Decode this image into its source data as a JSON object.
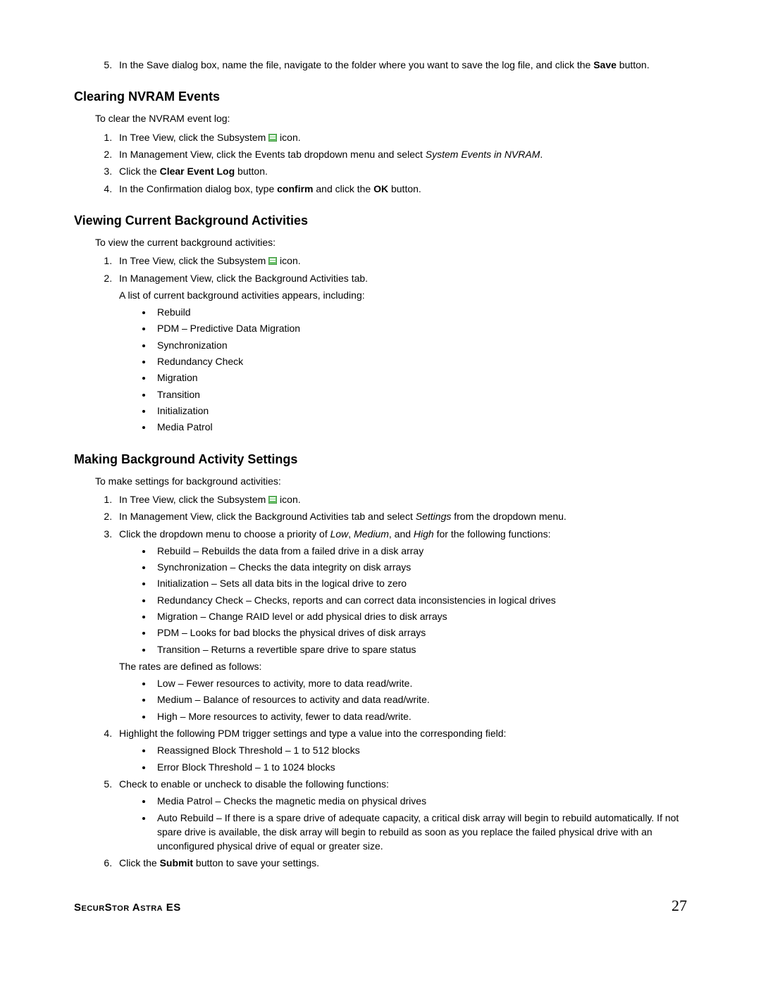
{
  "top_step5": {
    "pre": "In the Save dialog box, name the file, navigate to the folder where you want to save the log file, and click the ",
    "bold": "Save",
    "post": " button."
  },
  "section1": {
    "title": "Clearing NVRAM Events",
    "intro": "To clear the NVRAM event log:",
    "step1_pre": "In Tree View, click the Subsystem ",
    "step1_post": " icon.",
    "step2_pre": "In Management View, click the Events tab dropdown menu and select ",
    "step2_ital": "System Events in NVRAM",
    "step2_post": ".",
    "step3_pre": "Click the ",
    "step3_bold": "Clear Event Log",
    "step3_post": " button.",
    "step4_pre": "In the Confirmation dialog box, type ",
    "step4_bold1": "confirm",
    "step4_mid": " and click the ",
    "step4_bold2": "OK",
    "step4_post": " button."
  },
  "section2": {
    "title": "Viewing Current Background Activities",
    "intro": "To view the current background activities:",
    "step1_pre": "In Tree View, click the Subsystem ",
    "step1_post": " icon.",
    "step2": "In Management View, click the Background Activities tab.",
    "step2_sub": "A list of current background activities appears, including:",
    "bullets": [
      "Rebuild",
      "PDM – Predictive Data Migration",
      "Synchronization",
      "Redundancy Check",
      "Migration",
      "Transition",
      "Initialization",
      "Media Patrol"
    ]
  },
  "section3": {
    "title": "Making Background Activity Settings",
    "intro": "To make settings for background activities:",
    "step1_pre": "In Tree View, click the Subsystem ",
    "step1_post": " icon.",
    "step2_pre": "In Management View, click the Background Activities tab and select ",
    "step2_ital": "Settings",
    "step2_post": " from the dropdown menu.",
    "step3_pre": "Click the dropdown menu to choose a priority of ",
    "step3_i1": "Low",
    "step3_s1": ", ",
    "step3_i2": "Medium",
    "step3_s2": ", and ",
    "step3_i3": "High",
    "step3_post": " for the following functions:",
    "step3_bullets": [
      "Rebuild – Rebuilds the data from a failed drive in a disk array",
      "Synchronization – Checks the data integrity on disk arrays",
      "Initialization – Sets all data bits in the logical drive to zero",
      "Redundancy Check – Checks, reports and can correct data inconsistencies in logical drives",
      "Migration – Change RAID level or add physical dries to disk arrays",
      "PDM – Looks for bad blocks the physical drives of disk arrays",
      "Transition – Returns a revertible spare drive to spare status"
    ],
    "rates_intro": "The rates are defined as follows:",
    "rates_bullets": [
      "Low – Fewer resources to activity, more to data read/write.",
      "Medium – Balance of resources to activity and data read/write.",
      "High – More resources to activity, fewer to data read/write."
    ],
    "step4": "Highlight the following PDM trigger settings and type a value into the corresponding field:",
    "step4_bullets": [
      "Reassigned Block Threshold – 1 to 512 blocks",
      "Error Block Threshold – 1 to 1024 blocks"
    ],
    "step5": "Check to enable or uncheck to disable the following functions:",
    "step5_bullets": [
      "Media Patrol – Checks the magnetic media on physical drives",
      "Auto Rebuild – If there is a spare drive of adequate capacity, a critical disk array will begin to rebuild automatically. If not spare drive is available, the disk array will begin to rebuild as soon as you replace the failed physical drive with an unconfigured physical drive of equal or greater size."
    ],
    "step6_pre": "Click the ",
    "step6_bold": "Submit",
    "step6_post": " button to save your settings."
  },
  "footer": {
    "left": "SecurStor Astra ES",
    "right": "27"
  }
}
